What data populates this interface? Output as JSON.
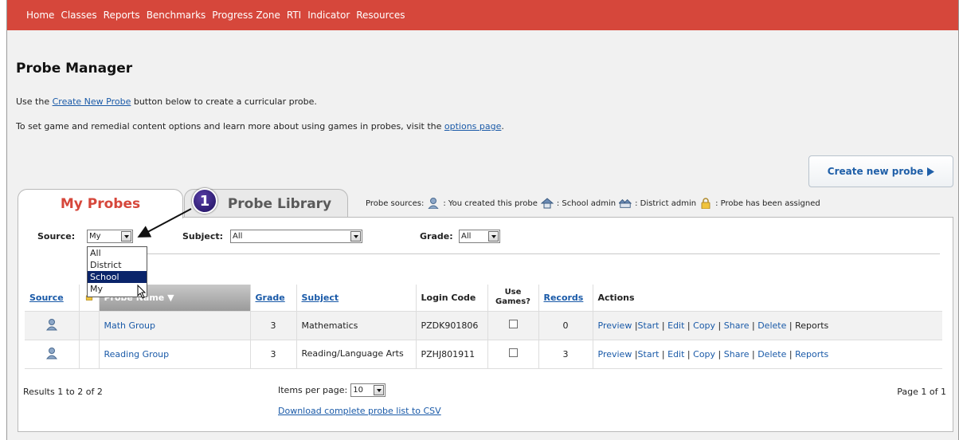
{
  "nav": {
    "items": [
      "Home",
      "Classes",
      "Reports",
      "Benchmarks",
      "Progress Zone",
      "RTI",
      "Indicator",
      "Resources"
    ]
  },
  "page": {
    "title": "Probe Manager",
    "line1_pre": "Use the ",
    "line1_link": "Create New Probe",
    "line1_post": " button below to create a curricular probe.",
    "line2_pre": "To set game and remedial content options and learn more about using games in probes, visit the ",
    "line2_link": "options page",
    "line2_post": "."
  },
  "create_button": {
    "label": "Create new probe",
    "icon": "play-arrow-icon"
  },
  "tabs": {
    "active": "My Probes",
    "inactive": "Probe Library"
  },
  "callout": {
    "number": "1"
  },
  "legend": {
    "label": "Probe sources:",
    "items": [
      {
        "icon": "user-icon",
        "text": ": You created this probe"
      },
      {
        "icon": "school-icon",
        "text": ": School admin"
      },
      {
        "icon": "district-icon",
        "text": ": District admin"
      },
      {
        "icon": "lock-icon",
        "text": ": Probe has been assigned"
      }
    ]
  },
  "filters": {
    "source_label": "Source:",
    "source_value": "My",
    "subject_label": "Subject:",
    "subject_value": "All",
    "grade_label": "Grade:",
    "grade_value": "All",
    "source_options": [
      "All",
      "District",
      "School",
      "My"
    ]
  },
  "table": {
    "headers": [
      "Source",
      "",
      "Probe Name ▼",
      "Grade",
      "Subject",
      "Login Code",
      "Use Games?",
      "Records",
      "Actions"
    ],
    "rows": [
      {
        "name": "Math Group",
        "grade": "3",
        "subject": "Mathematics",
        "code": "PZDK901806",
        "records": "0",
        "actions": [
          "Preview ",
          "Start",
          "Edit",
          "Copy",
          "Share",
          "Delete",
          "Reports"
        ]
      },
      {
        "name": "Reading Group",
        "grade": "3",
        "subject": "Reading/Language Arts",
        "code": "PZHJ801911",
        "records": "3",
        "actions": [
          "Preview ",
          "Start",
          "Edit",
          "Copy",
          "Share",
          "Delete",
          "Reports"
        ]
      }
    ]
  },
  "footer": {
    "results": "Results 1 to 2 of 2",
    "items_per_page_label": "Items per page:",
    "items_per_page_value": "10",
    "page": "Page 1 of 1",
    "csv_link": "Download complete probe list to CSV"
  },
  "colors": {
    "nav_bg": "#d6473b",
    "link": "#1a5aa8",
    "active_tab": "#d6473b"
  }
}
